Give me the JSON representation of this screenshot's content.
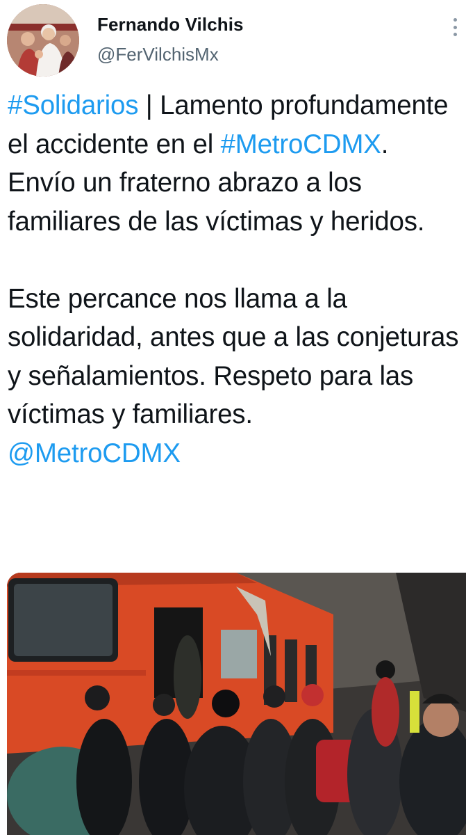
{
  "author": {
    "name": "Fernando Vilchis",
    "handle": "@FerVilchisMx"
  },
  "tweet": {
    "hashtag1": "#Solidarios",
    "line1_rest": " | Lamento profundamente el accidente en el ",
    "hashtag2": "#MetroCDMX",
    "line2_rest": ". Envío un fraterno abrazo a los familiares de las víctimas y heridos.",
    "paragraph2": "Este percance nos llama a la solidaridad, antes que a las conjeturas y señalamientos. Respeto para las víctimas y familiares.",
    "mention": "@MetroCDMX"
  },
  "icons": {
    "more": "more-options-vertical-icon"
  },
  "colors": {
    "link": "#1d9bf0",
    "text": "#0f1419",
    "secondary": "#536471"
  }
}
